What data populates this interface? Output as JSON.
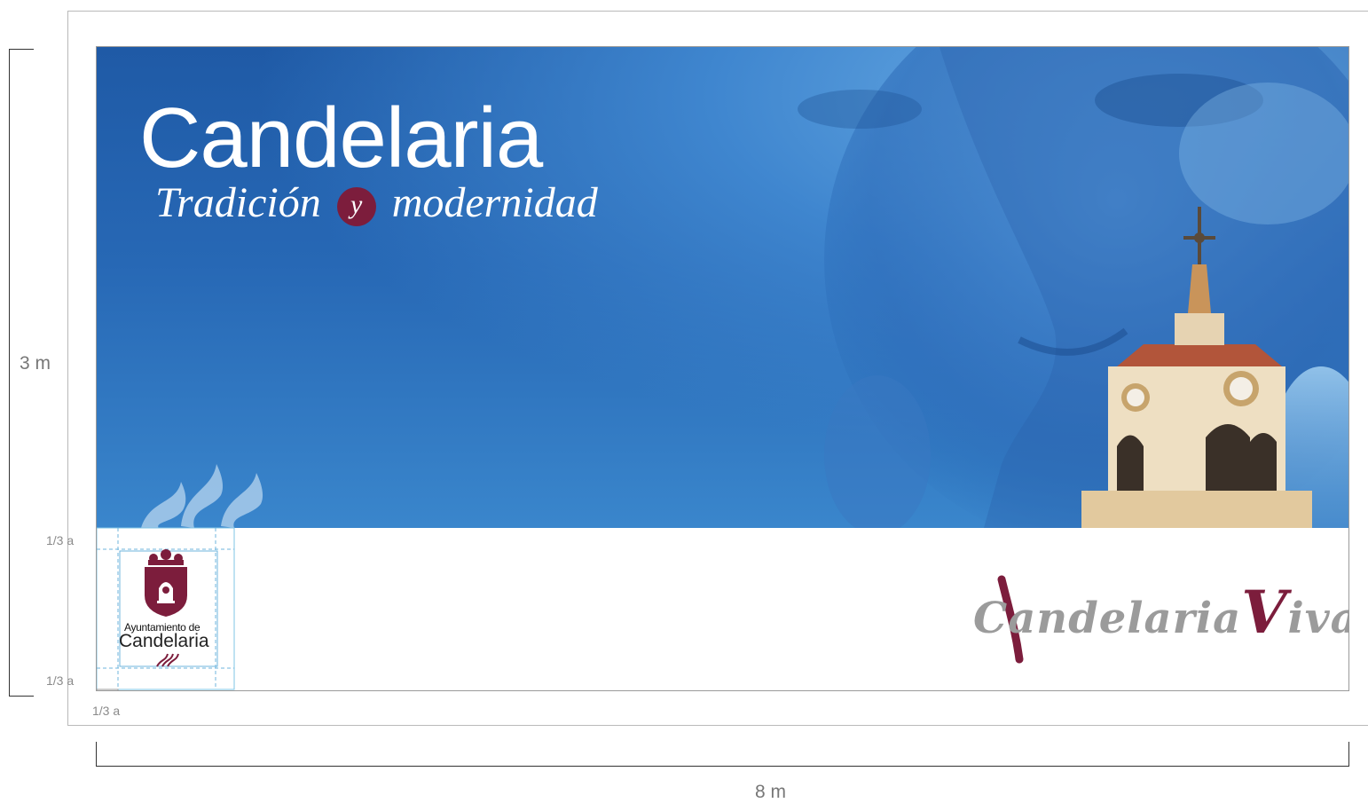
{
  "dimensions": {
    "height_label": "3 m",
    "width_label": "8 m"
  },
  "banner": {
    "title": "Candelaria",
    "subtitle_part1": "Tradición",
    "subtitle_connector": "y",
    "subtitle_part2": "modernidad"
  },
  "logo_ayuntamiento": {
    "line1": "Ayuntamiento de",
    "line2": "Candelaria"
  },
  "logo_viva": {
    "prefix": "Candelaria",
    "initial": "V",
    "suffix": "iva"
  },
  "spacing_labels": {
    "top": "1/3 a",
    "bottom": "1/3 a",
    "left": "1/3 a"
  },
  "colors": {
    "brand_burgundy": "#7c1d3c",
    "sky_blue": "#2768b5",
    "logo_grey": "#9b9b9b"
  }
}
